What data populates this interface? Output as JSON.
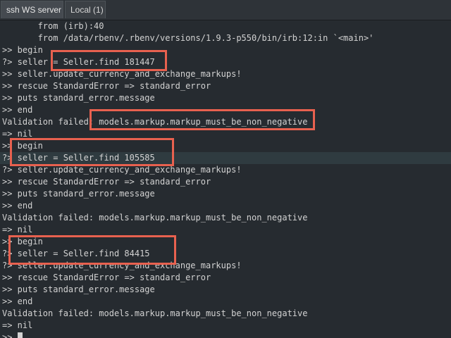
{
  "tabs": [
    {
      "label": "ssh WS server"
    },
    {
      "label": "Local (1)"
    }
  ],
  "terminal": {
    "lines": [
      "       from (irb):40",
      "       from /data/rbenv/.rbenv/versions/1.9.3-p550/bin/irb:12:in `<main>'",
      ">> begin",
      "?> seller = Seller.find 181447",
      ">> seller.update_currency_and_exchange_markups!",
      ">> rescue StandardError => standard_error",
      ">> puts standard_error.message",
      ">> end",
      "Validation failed: models.markup.markup_must_be_non_negative",
      "=> nil",
      ">> begin",
      "?> seller = Seller.find 105585",
      "?> seller.update_currency_and_exchange_markups!",
      ">> rescue StandardError => standard_error",
      ">> puts standard_error.message",
      ">> end",
      "Validation failed: models.markup.markup_must_be_non_negative",
      "=> nil",
      ">> begin",
      "?> seller = Seller.find 84415",
      "?> seller.update_currency_and_exchange_markups!",
      ">> rescue StandardError => standard_error",
      ">> puts standard_error.message",
      ">> end",
      "Validation failed: models.markup.markup_must_be_non_negative",
      "=> nil",
      ">> "
    ]
  },
  "colors": {
    "background": "#262b30",
    "text": "#d2d2d2",
    "annotation_box": "#e8614f",
    "current_line_highlight": "#2f3b40"
  }
}
